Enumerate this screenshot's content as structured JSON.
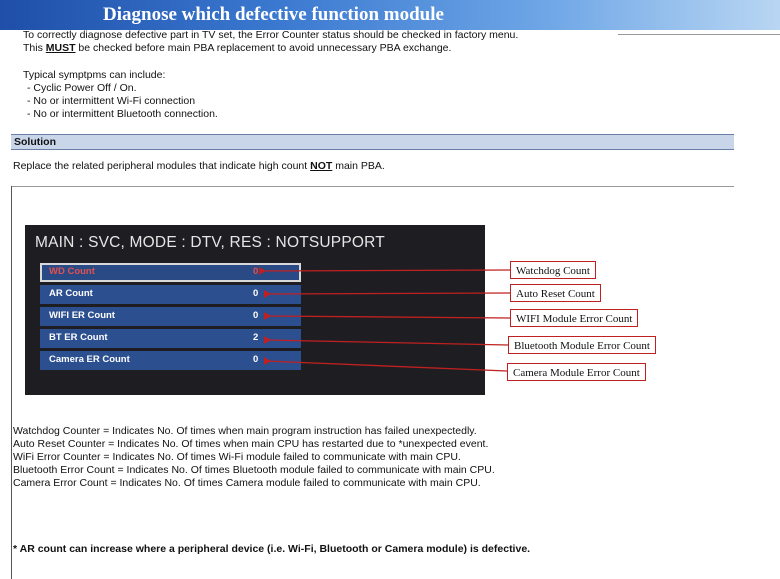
{
  "banner": {
    "title": "Diagnose which defective function module"
  },
  "intro": {
    "line1": "To correctly diagnose defective part in TV set, the Error Counter status should be checked in factory menu.",
    "line2_pre": "This ",
    "line2_must": "MUST",
    "line2_post": " be checked before main PBA replacement to avoid unnecessary PBA exchange."
  },
  "symptoms": {
    "heading": "Typical symptpms can include:",
    "items": [
      "- Cyclic Power Off / On.",
      "- No or  intermittent  Wi-Fi connection",
      "- No or intermittent Bluetooth connection."
    ]
  },
  "solution": {
    "label": "Solution",
    "text_pre": "Replace the related peripheral modules that indicate high count ",
    "text_not": "NOT",
    "text_post": " main PBA."
  },
  "tv_menu": {
    "header": "MAIN : SVC, MODE : DTV, RES : NOTSUPPORT",
    "rows": [
      {
        "label": "WD Count",
        "value": "0"
      },
      {
        "label": "AR Count",
        "value": "0"
      },
      {
        "label": "WIFI ER Count",
        "value": "0"
      },
      {
        "label": "BT ER Count",
        "value": "2"
      },
      {
        "label": "Camera ER Count",
        "value": "0"
      }
    ]
  },
  "callouts": [
    "Watchdog Count",
    "Auto Reset Count",
    "WIFI Module Error Count",
    "Bluetooth Module Error Count",
    "Camera Module Error Count"
  ],
  "definitions": [
    "Watchdog Counter = Indicates No. Of times when main program instruction has failed unexpectedly.",
    "Auto Reset Counter = Indicates No. Of times when main CPU has restarted due to *unexpected event.",
    "WiFi Error Counter = Indicates No. Of times Wi-Fi module failed to communicate with main CPU.",
    "Bluetooth Error Count = Indicates No. Of times Bluetooth module failed to communicate with main CPU.",
    "Camera Error Count = Indicates No. Of times Camera module failed to communicate with main CPU."
  ],
  "footnote": "* AR count can increase where a peripheral device (i.e. Wi-Fi, Bluetooth or Camera module) is defective.",
  "colors": {
    "banner": "#2f63bf",
    "arrow": "#c02020",
    "menu_row": "#2c4f8f",
    "selected_text": "#e05050"
  }
}
